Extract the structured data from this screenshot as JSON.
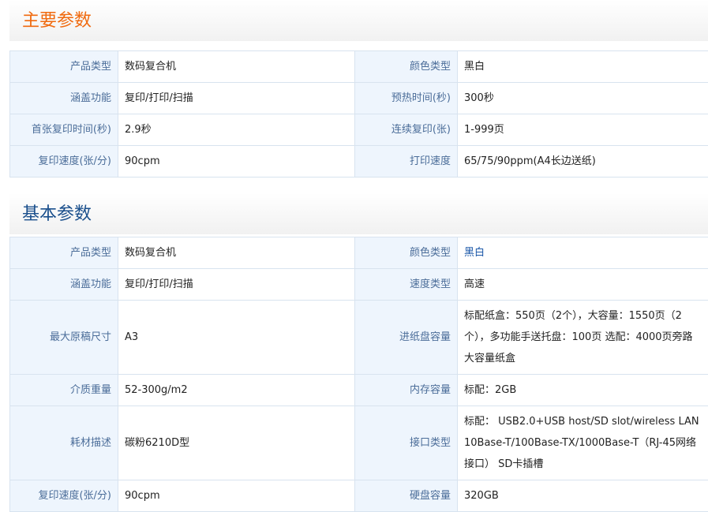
{
  "main": {
    "title": "主要参数",
    "rows": [
      {
        "l1": "产品类型",
        "v1": "数码复合机",
        "l2": "颜色类型",
        "v2": "黑白"
      },
      {
        "l1": "涵盖功能",
        "v1": "复印/打印/扫描",
        "l2": "预热时间(秒)",
        "v2": "300秒"
      },
      {
        "l1": "首张复印时间(秒)",
        "v1": "2.9秒",
        "l2": "连续复印(张)",
        "v2": "1-999页"
      },
      {
        "l1": "复印速度(张/分)",
        "v1": "90cpm",
        "l2": "打印速度",
        "v2": "65/75/90ppm(A4长边送纸)"
      }
    ]
  },
  "basic": {
    "title": "基本参数",
    "rows": [
      {
        "l1": "产品类型",
        "v1": "数码复合机",
        "l2": "颜色类型",
        "v2": "黑白"
      },
      {
        "l1": "涵盖功能",
        "v1": "复印/打印/扫描",
        "l2": "速度类型",
        "v2": "高速"
      },
      {
        "l1": "最大原稿尺寸",
        "v1": "A3",
        "l2": "进纸盘容量",
        "v2": "标配纸盒：550页（2个），大容量：1550页（2个），多功能手送托盘：100页 选配：4000页旁路大容量纸盒"
      },
      {
        "l1": "介质重量",
        "v1": "52-300g/m2",
        "l2": "内存容量",
        "v2": "标配：2GB"
      },
      {
        "l1": "耗材描述",
        "v1": "碳粉6210D型",
        "l2": "接口类型",
        "v2": "标配： USB2.0+USB host/SD slot/wireless LAN 10Base-T/100Base-TX/1000Base-T（RJ-45网络接口） SD卡插槽"
      },
      {
        "l1": "复印速度(张/分)",
        "v1": "90cpm",
        "l2": "硬盘容量",
        "v2": "320GB"
      }
    ]
  }
}
